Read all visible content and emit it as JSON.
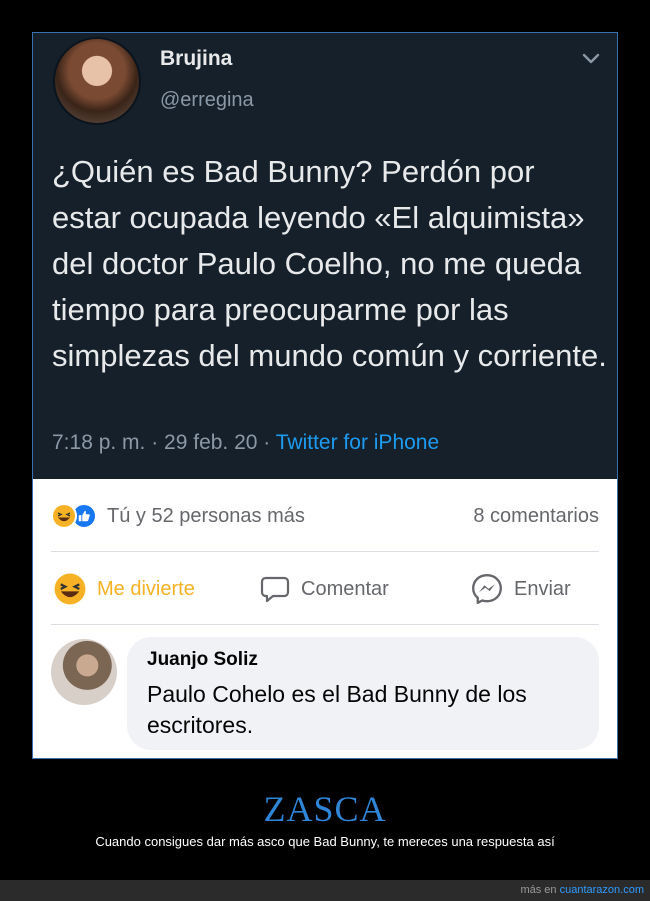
{
  "tweet": {
    "name": "Brujina",
    "handle": "@erregina",
    "text": "¿Quién es Bad Bunny? Perdón por estar ocupada leyendo «El alquimista» del doctor Paulo Coelho, no me queda tiempo para preocuparme por las simplezas del mundo común y corriente.",
    "time": "7:18 p. m. · 29 feb. 20 · ",
    "source": "Twitter for iPhone",
    "colors": {
      "background": "#15202b",
      "link": "#1d9bf0"
    }
  },
  "facebook": {
    "reactions_text": "Tú y 52 personas más",
    "comments_count": "8 comentarios",
    "actions": {
      "haha": "Me divierte",
      "comment": "Comentar",
      "send": "Enviar"
    },
    "comment": {
      "author": "Juanjo Soliz",
      "text": "Paulo Cohelo es el Bad Bunny de los escritores."
    },
    "icons": [
      "haha-icon",
      "like-icon",
      "comment-icon",
      "messenger-icon"
    ]
  },
  "post": {
    "title": "ZASCA",
    "caption": "Cuando consigues dar más asco que Bad Bunny, te mereces una respuesta así"
  },
  "footer": {
    "prefix": "más en ",
    "site": "cuantarazon.com"
  }
}
